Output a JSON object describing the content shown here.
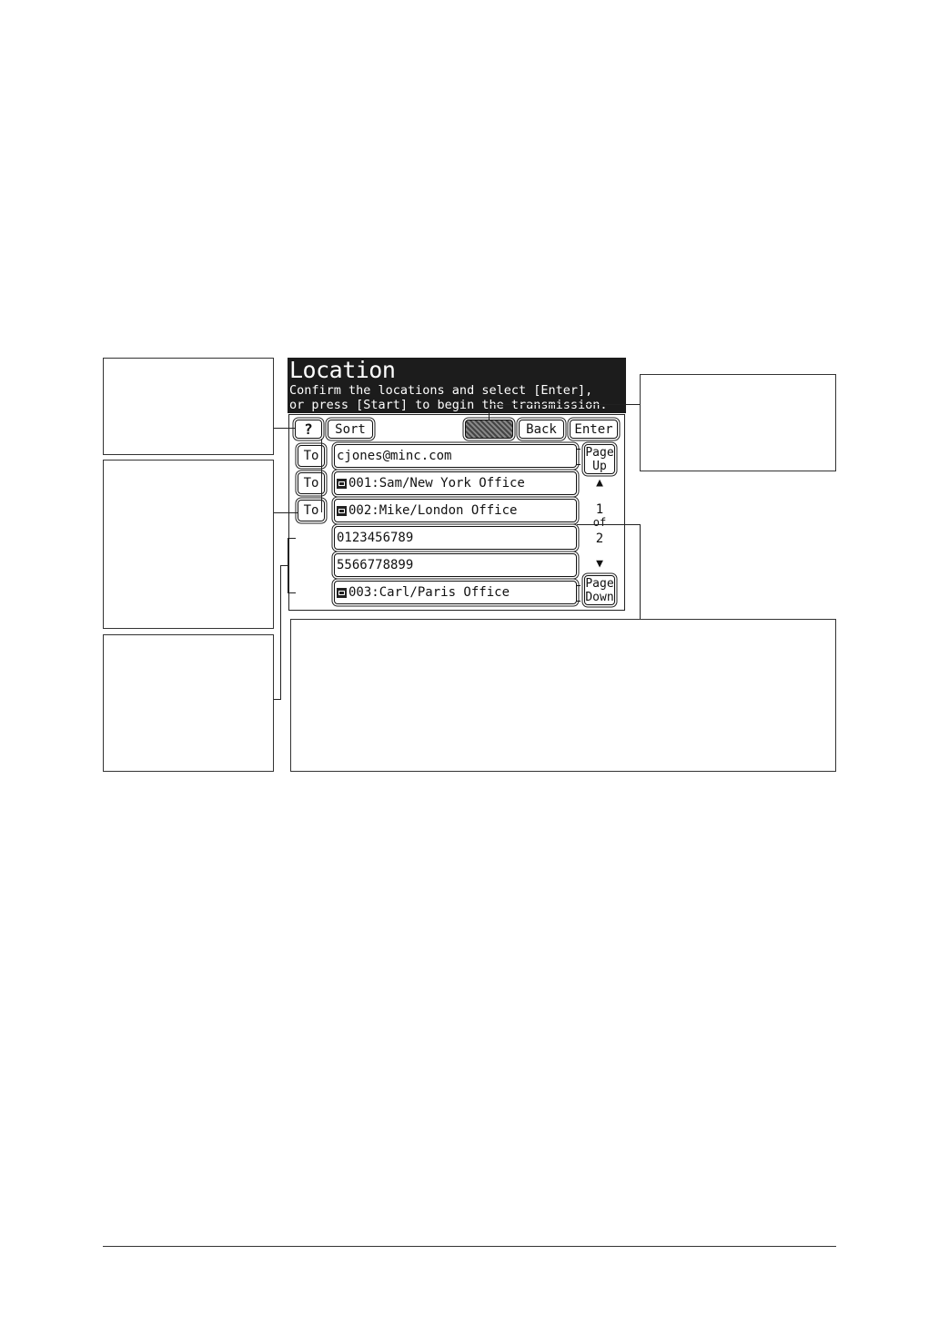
{
  "screen": {
    "title": "Location",
    "message_line1": "Confirm the locations and select [Enter],",
    "message_line2": "or press [Start] to begin the transmission."
  },
  "toolbar": {
    "help_label": "?",
    "sort_label": "Sort",
    "back_label": "Back",
    "enter_label": "Enter"
  },
  "to_buttons": [
    "To",
    "To",
    "To"
  ],
  "locations": [
    {
      "text": "cjones@minc.com",
      "icon": ""
    },
    {
      "text": "001:Sam/New York Office",
      "icon": "email-icon"
    },
    {
      "text": "002:Mike/London Office",
      "icon": "email-icon"
    },
    {
      "text": "0123456789",
      "icon": ""
    },
    {
      "text": "5566778899",
      "icon": ""
    },
    {
      "text": "003:Carl/Paris Office",
      "icon": "fax-icon"
    }
  ],
  "pager": {
    "page_up_line1": "Page",
    "page_up_line2": "Up",
    "up_arrow": "▲",
    "current": "1",
    "of": "of",
    "total": "2",
    "down_arrow": "▼",
    "page_down_line1": "Page",
    "page_down_line2": "Down"
  }
}
